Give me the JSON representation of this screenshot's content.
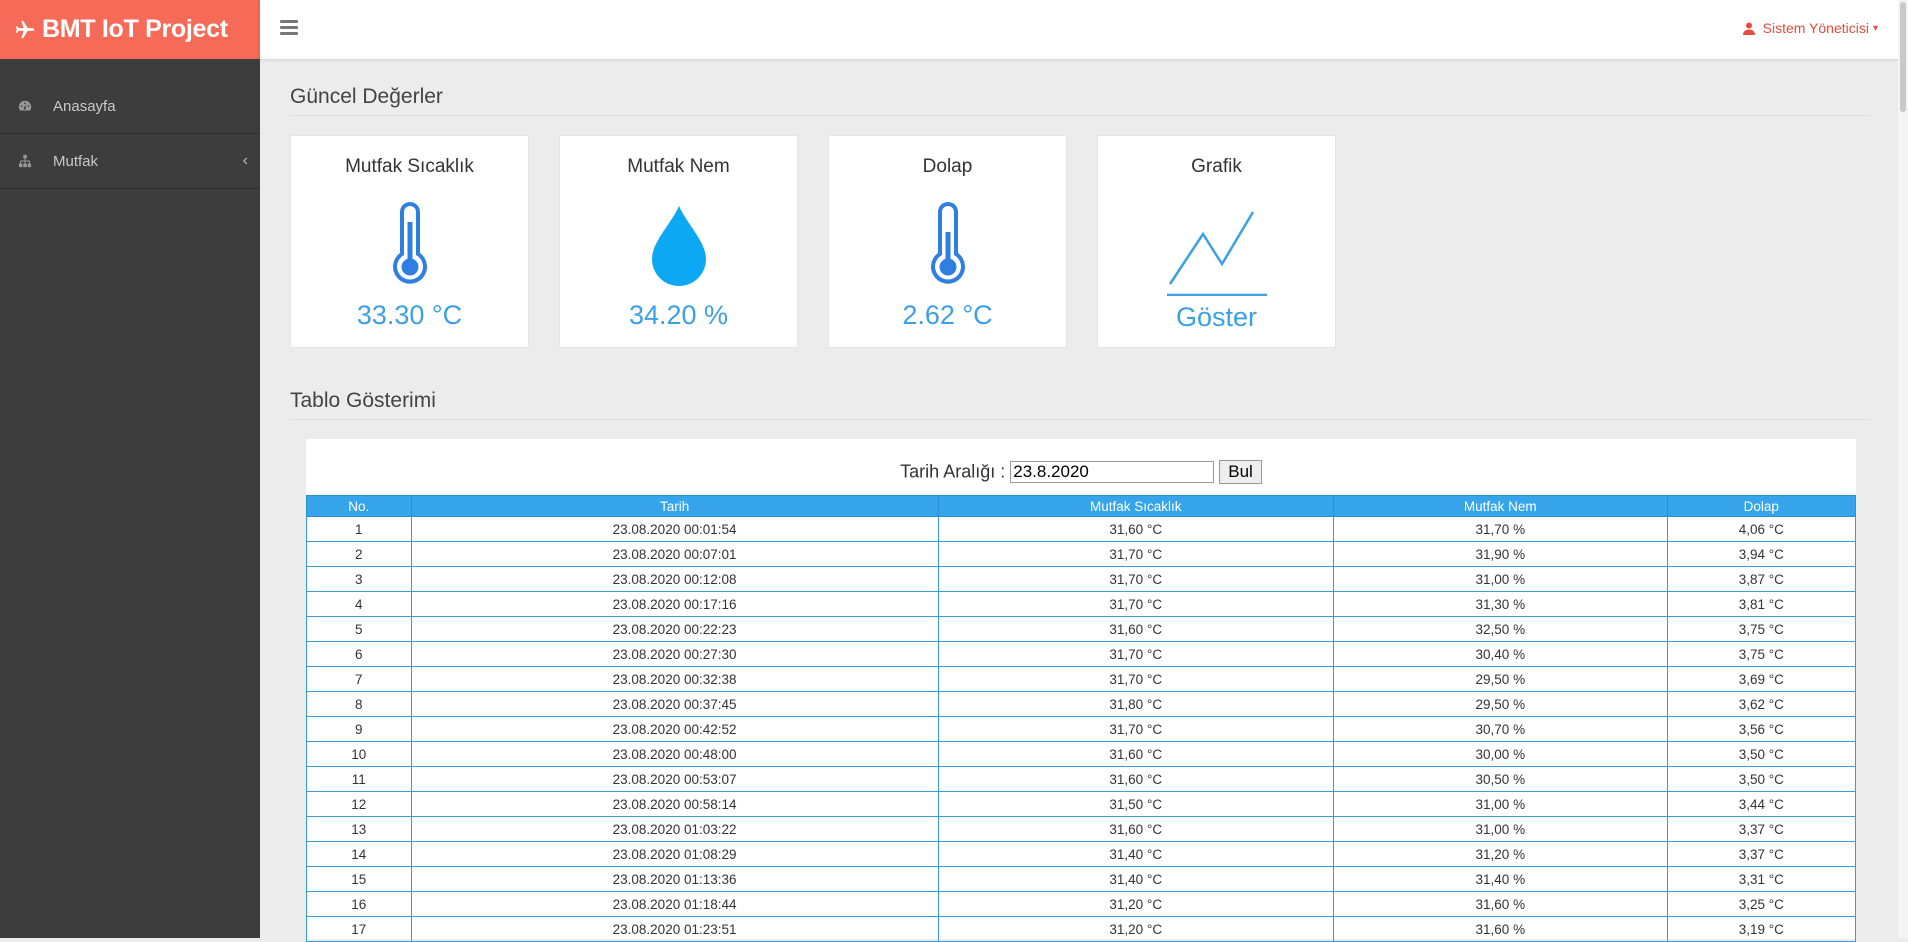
{
  "brand": {
    "title": "BMT IoT Project",
    "color": "#f66a58"
  },
  "sidebar": {
    "items": [
      {
        "label": "Anasayfa",
        "icon": "dashboard-icon"
      },
      {
        "label": "Mutfak",
        "icon": "sitemap-icon",
        "chevron": "‹"
      }
    ]
  },
  "header": {
    "user": "Sistem Yöneticisi",
    "caret": "▾"
  },
  "current": {
    "title": "Güncel Değerler",
    "cards": [
      {
        "title": "Mutfak Sıcaklık",
        "value": "33.30 °C",
        "icon": "thermometer-icon"
      },
      {
        "title": "Mutfak Nem",
        "value": "34.20 %",
        "icon": "water-drop-icon"
      },
      {
        "title": "Dolap",
        "value": "2.62 °C",
        "icon": "thermometer-icon"
      },
      {
        "title": "Grafik",
        "value": "Göster",
        "icon": "line-chart-icon"
      }
    ]
  },
  "table_section": {
    "title": "Tablo Gösterimi",
    "filter_label": "Tarih Aralığı :",
    "filter_value": "23.8.2020",
    "button_label": "Bul",
    "columns": [
      "No.",
      "Tarih",
      "Mutfak Sıcaklık",
      "Mutfak Nem",
      "Dolap"
    ],
    "rows": [
      [
        "1",
        "23.08.2020 00:01:54",
        "31,60 °C",
        "31,70 %",
        "4,06 °C"
      ],
      [
        "2",
        "23.08.2020 00:07:01",
        "31,70 °C",
        "31,90 %",
        "3,94 °C"
      ],
      [
        "3",
        "23.08.2020 00:12:08",
        "31,70 °C",
        "31,00 %",
        "3,87 °C"
      ],
      [
        "4",
        "23.08.2020 00:17:16",
        "31,70 °C",
        "31,30 %",
        "3,81 °C"
      ],
      [
        "5",
        "23.08.2020 00:22:23",
        "31,60 °C",
        "32,50 %",
        "3,75 °C"
      ],
      [
        "6",
        "23.08.2020 00:27:30",
        "31,70 °C",
        "30,40 %",
        "3,75 °C"
      ],
      [
        "7",
        "23.08.2020 00:32:38",
        "31,70 °C",
        "29,50 %",
        "3,69 °C"
      ],
      [
        "8",
        "23.08.2020 00:37:45",
        "31,80 °C",
        "29,50 %",
        "3,62 °C"
      ],
      [
        "9",
        "23.08.2020 00:42:52",
        "31,70 °C",
        "30,70 %",
        "3,56 °C"
      ],
      [
        "10",
        "23.08.2020 00:48:00",
        "31,60 °C",
        "30,00 %",
        "3,50 °C"
      ],
      [
        "11",
        "23.08.2020 00:53:07",
        "31,60 °C",
        "30,50 %",
        "3,50 °C"
      ],
      [
        "12",
        "23.08.2020 00:58:14",
        "31,50 °C",
        "31,00 %",
        "3,44 °C"
      ],
      [
        "13",
        "23.08.2020 01:03:22",
        "31,60 °C",
        "31,00 %",
        "3,37 °C"
      ],
      [
        "14",
        "23.08.2020 01:08:29",
        "31,40 °C",
        "31,20 %",
        "3,37 °C"
      ],
      [
        "15",
        "23.08.2020 01:13:36",
        "31,40 °C",
        "31,40 %",
        "3,31 °C"
      ],
      [
        "16",
        "23.08.2020 01:18:44",
        "31,20 °C",
        "31,60 %",
        "3,25 °C"
      ],
      [
        "17",
        "23.08.2020 01:23:51",
        "31,20 °C",
        "31,60 %",
        "3,19 °C"
      ]
    ]
  }
}
